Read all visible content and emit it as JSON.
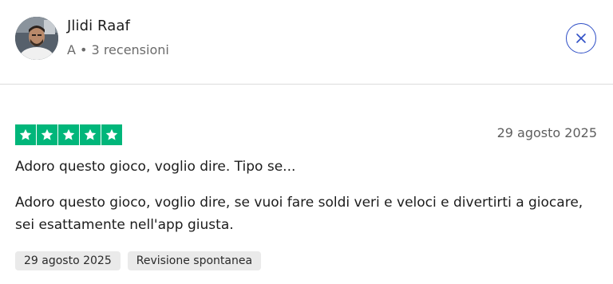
{
  "reviewer": {
    "name": "Jlidi Raaf",
    "meta": "A • 3 recensioni"
  },
  "review": {
    "rating": 5,
    "rating_max": 5,
    "date": "29 agosto 2025",
    "title": "Adoro questo gioco, voglio dire. Tipo se...",
    "text": "Adoro questo gioco, voglio dire, se vuoi fare soldi veri e veloci e divertirti a giocare, sei esattamente nell'app giusta.",
    "tags": [
      "29 agosto 2025",
      "Revisione spontanea"
    ]
  },
  "colors": {
    "star_fill": "#00b67a",
    "close_accent": "#2f4fc6",
    "tag_background": "#eaeaea"
  },
  "icons": {
    "close": "close-icon",
    "star": "star-icon"
  }
}
